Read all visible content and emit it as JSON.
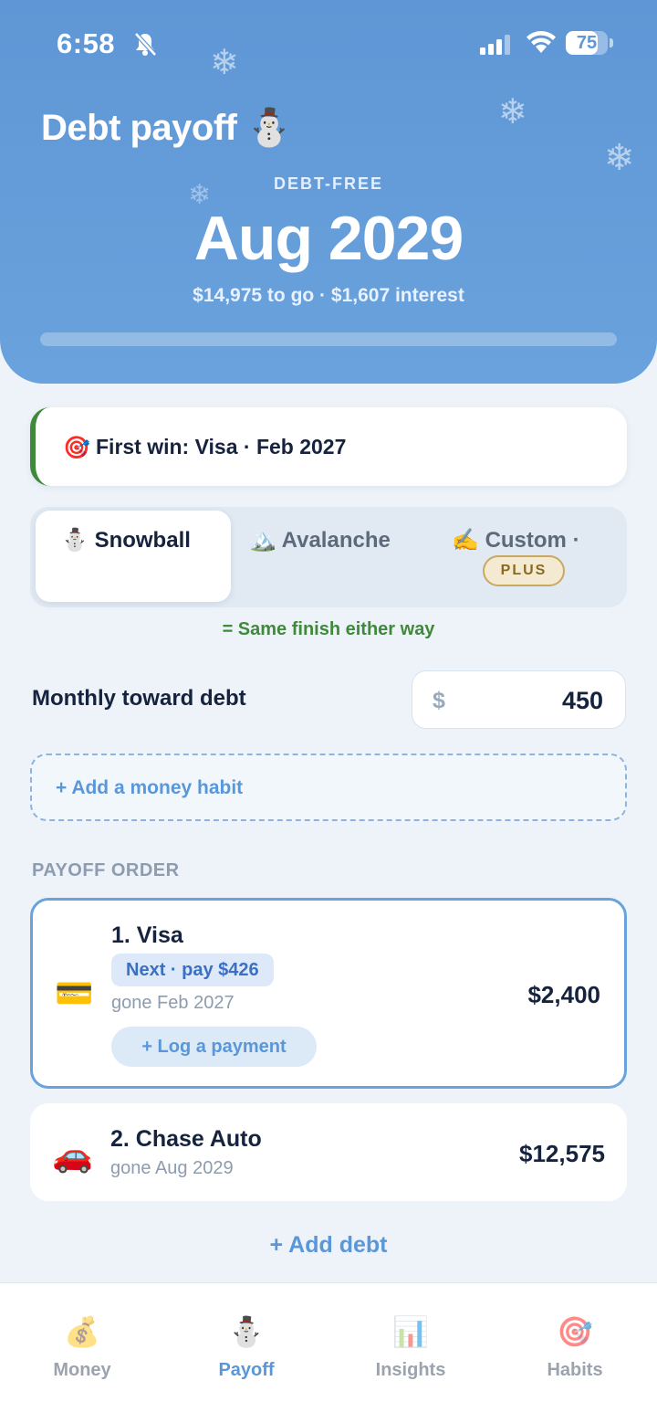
{
  "status_bar": {
    "time": "6:58",
    "battery": "75",
    "battery_level": 0.75
  },
  "header": {
    "title": "Debt payoff ⛄",
    "eyebrow": "DEBT-FREE",
    "debt_free_date": "Aug 2029",
    "summary": "$14,975 to go · $1,607 interest",
    "progress": 0.0
  },
  "first_win": {
    "emoji": "🎯",
    "text": "First win: Visa · Feb 2027"
  },
  "strategy": {
    "tabs": [
      {
        "emoji": "⛄",
        "label": "Snowball",
        "active": true
      },
      {
        "emoji": "🏔️",
        "label": "Avalanche",
        "active": false
      },
      {
        "emoji": "✍️",
        "label": "Custom ·",
        "active": false,
        "badge": "PLUS"
      }
    ],
    "note": "= Same finish either way"
  },
  "monthly": {
    "label": "Monthly toward debt",
    "currency": "$",
    "value": "450"
  },
  "add_habit": {
    "label": "+ Add a money habit"
  },
  "payoff_order": {
    "heading": "PAYOFF ORDER",
    "debts": [
      {
        "icon": "credit-card-icon",
        "emoji": "💳",
        "name": "1. Visa",
        "next_label": "Next · pay $426",
        "gone": "gone Feb 2027",
        "log_label": "+ Log a payment",
        "amount": "$2,400"
      },
      {
        "icon": "car-icon",
        "emoji": "🚗",
        "name": "2. Chase Auto",
        "gone": "gone Aug 2029",
        "amount": "$12,575"
      }
    ],
    "add_debt": "+ Add debt"
  },
  "tabbar": {
    "tabs": [
      {
        "emoji": "💰",
        "label": "Money",
        "active": false
      },
      {
        "emoji": "⛄",
        "label": "Payoff",
        "active": true
      },
      {
        "emoji": "📊",
        "label": "Insights",
        "active": false
      },
      {
        "emoji": "🎯",
        "label": "Habits",
        "active": false
      }
    ]
  },
  "colors": {
    "hero": "#6aa2dd",
    "accent": "#5a97d8",
    "win_green": "#3f8a3a",
    "plus_gold": "#c9a862"
  }
}
